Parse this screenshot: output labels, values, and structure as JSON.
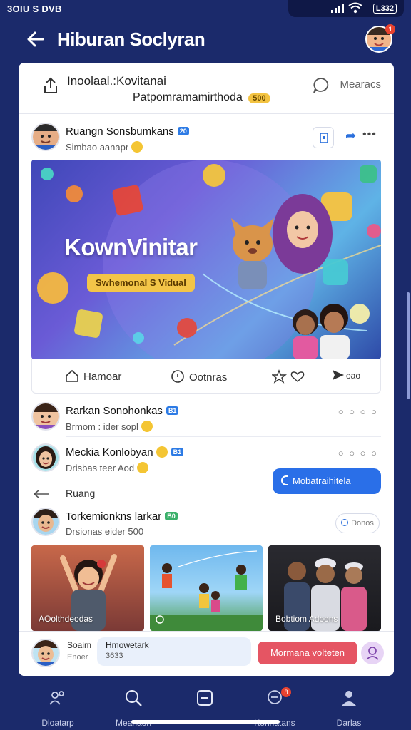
{
  "status_bar": {
    "left_text": "3OIU S DVB",
    "battery": "L332"
  },
  "header": {
    "title": "Hiburan Soclyran",
    "notification_count": "1"
  },
  "share_bar": {
    "title": "Inoolaal.:Kovitanai",
    "subtitle": "Patpomramamirthoda",
    "badge": "500",
    "message_label": "Mearacs"
  },
  "post": {
    "author": "Ruangn Sonsbumkans",
    "verified_badge": "20",
    "sub": "Simbao aanapr",
    "banner": {
      "title": "KownVinitar",
      "pill": "Swhemonal S Vidual"
    },
    "actions": {
      "like": "Hamoar",
      "comment": "Ootnras",
      "share_count": "oao"
    }
  },
  "comments": [
    {
      "name": "Rarkan Sonohonkas",
      "badge": "B1",
      "sub": "Brmom : ider sopl"
    },
    {
      "name": "Meckia Konlobyan",
      "badge": "B1",
      "sub": "Drisbas teer Aod"
    },
    {
      "name": "Torkemionkns larkar",
      "badge": "B0",
      "sub": "Drsionas eider 500"
    }
  ],
  "follow_button": "Mobatraihitela",
  "reply": {
    "label": "Ruang"
  },
  "listen_button": "Donos",
  "thumbnails": [
    {
      "caption": "AOolthdeodas"
    },
    {
      "caption": ""
    },
    {
      "caption": "Bobtiom Adoons"
    }
  ],
  "composer": {
    "user_label": "Soaim",
    "user_sub": "Enoer",
    "input_main": "Hmowetark",
    "input_sub": "3633",
    "send_label": "Mormana volteten"
  },
  "bottom_nav": [
    {
      "label": "Dloatarp",
      "icon": "people-icon"
    },
    {
      "label": "Meanaon",
      "icon": "search-icon"
    },
    {
      "label": "",
      "icon": "tasks-icon"
    },
    {
      "label": "Konnatans",
      "icon": "chat-icon",
      "badge": "8"
    },
    {
      "label": "Darlas",
      "icon": "profile-icon"
    }
  ],
  "colors": {
    "background": "#1b2a6b",
    "accent": "#2a6fe8",
    "send": "#e55563"
  }
}
